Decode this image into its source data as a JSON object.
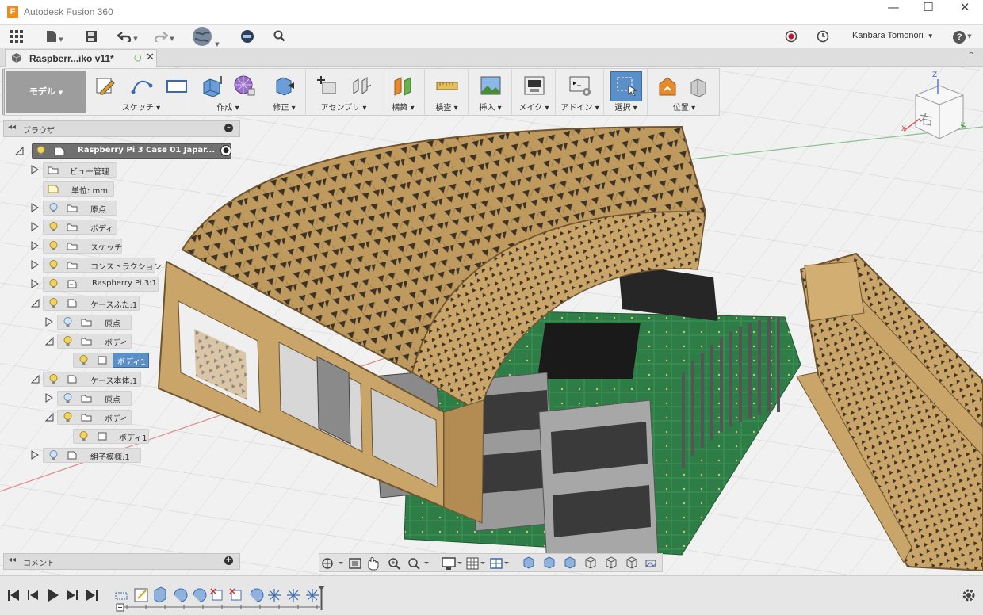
{
  "window": {
    "title": "Autodesk Fusion 360",
    "logo_letter": "F"
  },
  "app_toolbar": {
    "user_name": "Kanbara Tomonori",
    "help": "?"
  },
  "document_tab": {
    "label": "Raspberr...iko v11*"
  },
  "ribbon": {
    "workspace": "モデル",
    "groups": [
      {
        "label": "スケッチ"
      },
      {
        "label": "作成"
      },
      {
        "label": "修正"
      },
      {
        "label": "アセンブリ"
      },
      {
        "label": "構築"
      },
      {
        "label": "検査"
      },
      {
        "label": "挿入"
      },
      {
        "label": "メイク"
      },
      {
        "label": "アドイン"
      },
      {
        "label": "選択"
      },
      {
        "label": "位置"
      }
    ]
  },
  "browser": {
    "title": "ブラウザ",
    "root": "Raspberry Pi 3 Case 01 Japar...",
    "nodes": [
      {
        "label": "ビュー管理"
      },
      {
        "label": "単位: mm"
      },
      {
        "label": "原点"
      },
      {
        "label": "ボディ"
      },
      {
        "label": "スケッチ"
      },
      {
        "label": "コンストラクション"
      },
      {
        "label": "Raspberry Pi 3:1"
      },
      {
        "label": "ケースふた:1"
      },
      {
        "label": "原点"
      },
      {
        "label": "ボディ"
      },
      {
        "label": "ボディ1"
      },
      {
        "label": "ケース本体:1"
      },
      {
        "label": "原点"
      },
      {
        "label": "ボディ"
      },
      {
        "label": "ボディ1"
      },
      {
        "label": "組子模様:1"
      }
    ]
  },
  "comments": {
    "title": "コメント"
  },
  "viewcube": {
    "face_label": "右",
    "axis_x": "X",
    "axis_y": "Y",
    "axis_z": "Z"
  },
  "colors": {
    "wood": "#c9a56a",
    "wood_dark": "#8a6a3a",
    "pcb": "#2e7a45",
    "accent": "#f08c1c",
    "selected": "#5b8fc7"
  }
}
